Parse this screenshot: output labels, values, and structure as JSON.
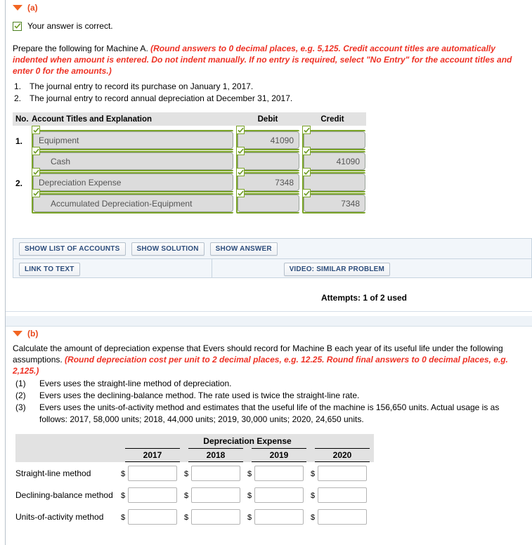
{
  "colors": {
    "accent_orange": "#f26522",
    "instruction_red": "#ee3124",
    "valid_green": "#7ba428",
    "button_blue": "#2c4d7c",
    "header_gray": "#e2e2e2"
  },
  "section_a": {
    "marker": "(a)",
    "status": {
      "icon": "checkmark-icon",
      "text": "Your answer is correct."
    },
    "instruction": {
      "lead": "Prepare the following for Machine A. ",
      "emphasis": "(Round answers to 0 decimal places, e.g. 5,125. Credit account titles are automatically indented when amount is entered. Do not indent manually. If no entry is required, select \"No Entry\" for the account titles and enter 0 for the amounts.)"
    },
    "requirements": [
      {
        "num": "1.",
        "text": "The journal entry to record its purchase on January 1, 2017."
      },
      {
        "num": "2.",
        "text": "The journal entry to record annual depreciation at December 31, 2017."
      }
    ],
    "journal": {
      "headers": {
        "no": "No.",
        "account": "Account Titles and Explanation",
        "debit": "Debit",
        "credit": "Credit"
      },
      "rows": [
        {
          "no": "1.",
          "account": "Equipment",
          "indent": false,
          "debit": "41090",
          "credit": ""
        },
        {
          "no": "",
          "account": "Cash",
          "indent": true,
          "debit": "",
          "credit": "41090"
        },
        {
          "no": "2.",
          "account": "Depreciation Expense",
          "indent": false,
          "debit": "7348",
          "credit": ""
        },
        {
          "no": "",
          "account": "Accumulated Depreciation-Equipment",
          "indent": true,
          "debit": "",
          "credit": "7348"
        }
      ]
    },
    "actions": {
      "show_list_of_accounts": "SHOW LIST OF ACCOUNTS",
      "show_solution": "SHOW SOLUTION",
      "show_answer": "SHOW ANSWER",
      "link_to_text": "LINK TO TEXT",
      "video_similar_problem": "VIDEO: SIMILAR PROBLEM"
    },
    "attempts": "Attempts: 1 of 2 used"
  },
  "section_b": {
    "marker": "(b)",
    "instruction": {
      "lead": "Calculate the amount of depreciation expense that Evers should record for Machine B each year of its useful life under the following assumptions. ",
      "emphasis": "(Round depreciation cost per unit to 2 decimal places, e.g. 12.25. Round final answers to 0 decimal places, e.g. 2,125.)"
    },
    "assumptions": [
      {
        "num": "(1)",
        "text": "Evers uses the straight-line method of depreciation."
      },
      {
        "num": "(2)",
        "text": "Evers uses the declining-balance method. The rate used is twice the straight-line rate."
      },
      {
        "num": "(3)",
        "text": "Evers uses the units-of-activity method and estimates that the useful life of the machine is 156,650 units. Actual usage is as follows: 2017, 58,000 units; 2018, 44,000 units; 2019, 30,000 units; 2020, 24,650 units."
      }
    ],
    "table": {
      "group_title": "Depreciation Expense",
      "years": [
        "2017",
        "2018",
        "2019",
        "2020"
      ],
      "currency_symbol": "$",
      "rows": [
        {
          "label": "Straight-line method",
          "values": [
            "",
            "",
            "",
            ""
          ]
        },
        {
          "label": "Declining-balance method",
          "values": [
            "",
            "",
            "",
            ""
          ]
        },
        {
          "label": "Units-of-activity method",
          "values": [
            "",
            "",
            "",
            ""
          ]
        }
      ]
    }
  }
}
